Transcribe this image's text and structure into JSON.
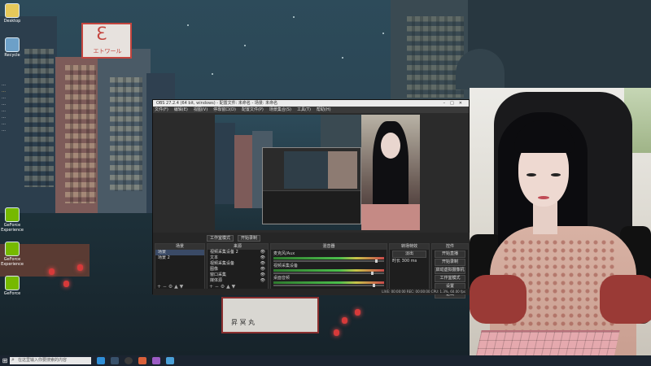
{
  "desktop": {
    "icons": [
      {
        "label": "Desktop",
        "icon": "folder-icon"
      },
      {
        "label": "Recycle",
        "icon": "recycle-bin-icon"
      },
      {
        "label": "",
        "icon": "app-icon"
      },
      {
        "label": "",
        "icon": "app-icon"
      }
    ],
    "bottom_icons": [
      {
        "label": "GeForce Experience",
        "icon": "geforce-icon"
      },
      {
        "label": "GeForce Experience",
        "icon": "geforce-icon"
      },
      {
        "label": "GeForce",
        "icon": "geforce-icon"
      }
    ],
    "shop_sign": "エトワール",
    "boat_sign": "昇 冥 丸"
  },
  "chat_overlay": {
    "lines": [
      "…",
      "…",
      "…",
      "…",
      "…",
      "…",
      "…",
      "…"
    ]
  },
  "taskbar": {
    "search_placeholder": "在这里输入你要搜索的内容",
    "apps": [
      {
        "name": "edge-icon",
        "color": "#2f8fd8"
      },
      {
        "name": "steam-icon",
        "color": "#38516b"
      },
      {
        "name": "obs-icon",
        "color": "#3b3b3b"
      },
      {
        "name": "app-icon",
        "color": "#d9603a"
      },
      {
        "name": "app-icon",
        "color": "#9b5cc4"
      },
      {
        "name": "app-icon",
        "color": "#4aa0d8"
      }
    ]
  },
  "obs": {
    "title": "OBS 27.2.4 (64 bit, windows) - 配置文件: 未命名 - 场景: 未命名",
    "menu": [
      "文件(F)",
      "编辑(E)",
      "视图(V)",
      "停靠窗口(D)",
      "配置文件(P)",
      "场景集合(S)",
      "工具(T)",
      "帮助(H)"
    ],
    "modes": [
      "工作室模式",
      "开始录制"
    ],
    "docks": {
      "scenes": {
        "header": "场景",
        "items": [
          "场景",
          "场景 2"
        ]
      },
      "sources": {
        "header": "来源",
        "items": [
          "视频采集设备 2",
          "文本",
          "视频采集设备",
          "图像",
          "窗口采集",
          "媒体源",
          "显示器采集"
        ]
      },
      "mixer": {
        "header": "混音器",
        "channels": [
          "麦克风/Aux",
          "视频采集设备",
          "桌面音频"
        ]
      },
      "transitions": {
        "header": "转场特效",
        "value": "淡出",
        "duration_label": "时长",
        "duration": "300 ms"
      },
      "controls": {
        "header": "控件",
        "buttons": [
          "开始直播",
          "开始录制",
          "启动虚拟摄像机",
          "工作室模式",
          "设置",
          "退出"
        ]
      }
    },
    "status": "LIVE: 00:00:00   REC: 00:00:00   CPU: 1.3%, 60.00 fps"
  },
  "colors": {
    "accent_live": "#c94a4a",
    "obs_bg": "#2b2b2b",
    "selection": "#3a4a66"
  }
}
